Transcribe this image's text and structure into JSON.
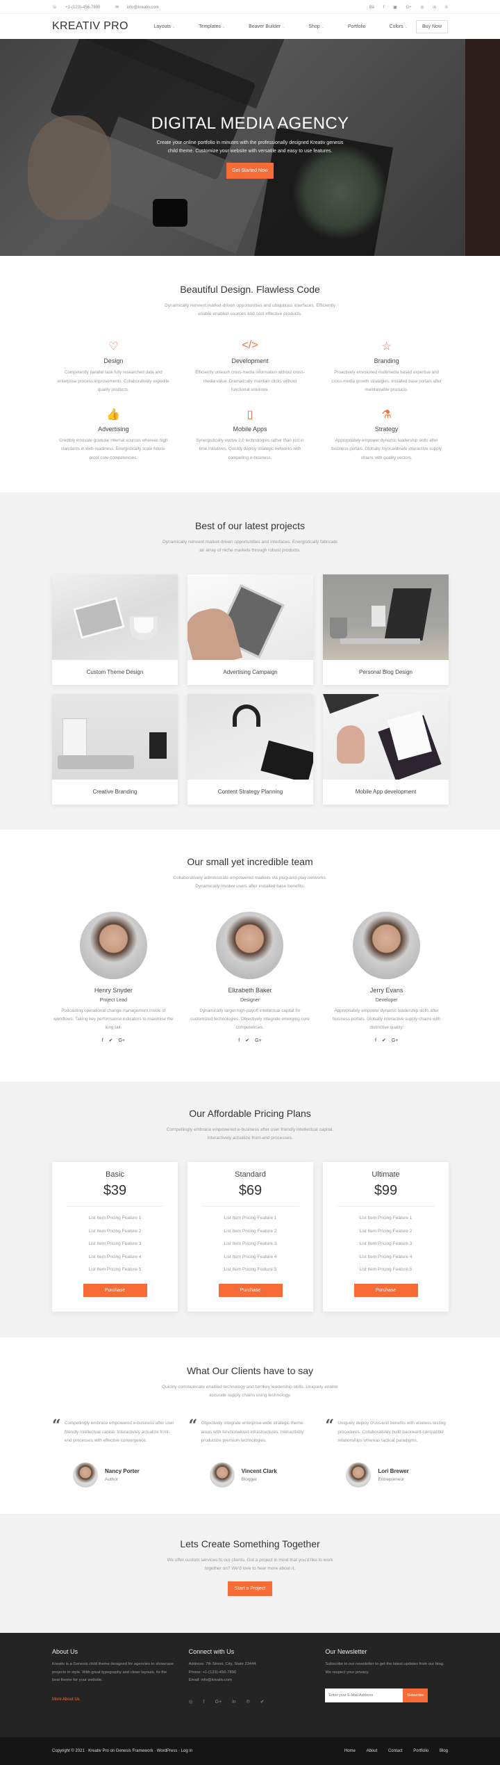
{
  "topbar": {
    "phone": "+1-(123)-456-7890",
    "email": "info@kreativ.com",
    "socials": [
      "behance-icon",
      "facebook-icon",
      "flickr-icon",
      "google-plus-icon",
      "dribbble-icon",
      "linkedin-icon",
      "pinterest-icon"
    ],
    "social_glyphs": [
      "Bē",
      "f",
      "▣",
      "G+",
      "◎",
      "in",
      "℗"
    ]
  },
  "header": {
    "logo": "KREATIV PRO",
    "nav": [
      {
        "label": "Layouts",
        "dropdown": true
      },
      {
        "label": "Templates",
        "dropdown": true
      },
      {
        "label": "Beaver Builder",
        "dropdown": true
      },
      {
        "label": "Shop",
        "dropdown": true
      },
      {
        "label": "Portfolio",
        "dropdown": false
      },
      {
        "label": "Colors",
        "dropdown": true
      }
    ],
    "buy_label": "Buy Now",
    "caret": "⌄"
  },
  "hero": {
    "title": "DIGITAL MEDIA AGENCY",
    "subtitle_1": "Create your online portfolio in minutes with the professionally designed Kreativ genesis",
    "subtitle_2": "child theme. Customize your website with versatile and easy to use features.",
    "button": "Get Started Now"
  },
  "features": {
    "title": "Beautiful Design. Flawless Code",
    "sub_1": "Dynamically reinvent market-driven opportunities and ubiquitous interfaces. Efficiently",
    "sub_2": "enable enabled sources and cost effective products.",
    "items": [
      {
        "icon": "♡",
        "title": "Design",
        "text": "Competently parallel task fully researched data and enterprise process improvements. Collaboratively expedite quality products."
      },
      {
        "icon": "</>",
        "title": "Development",
        "text": "Efficiently unleash cross-media information without cross-media value. Dramatically maintain clicks without functional solutions."
      },
      {
        "icon": "☆",
        "title": "Branding",
        "text": "Proactively envisioned multimedia based expertise and cross-media growth strategies. Installed base portals after maintainable products."
      },
      {
        "icon": "👍",
        "title": "Advertising",
        "text": "Credibly innovate granular internal sources whereas high standards in web-readiness. Energistically scale future-proof core competencies."
      },
      {
        "icon": "▯",
        "title": "Mobile Apps",
        "text": "Synergistically evolve 2.0 technologies rather than just in time initiatives. Quickly deploy strategic networks with compelling e-business."
      },
      {
        "icon": "⚗",
        "title": "Strategy",
        "text": "Appropriately empower dynamic leadership skills after business portals. Globally myocardinate interactive supply chains with quality vectors."
      }
    ]
  },
  "projects": {
    "title": "Best of our latest projects",
    "sub_1": "Dynamically reinvent market-driven opportunities and interfaces. Energistically fabricate",
    "sub_2": "an array of niche markets through robust products.",
    "items": [
      {
        "caption": "Custom Theme Design"
      },
      {
        "caption": "Advertising Campaign"
      },
      {
        "caption": "Personal Blog Design"
      },
      {
        "caption": "Creative Branding"
      },
      {
        "caption": "Content Strategy Planning"
      },
      {
        "caption": "Mobile App development"
      }
    ]
  },
  "team": {
    "title": "Our small yet incredible team",
    "sub_1": "Collaboratively administrate empowered markets via plug-and-play networks.",
    "sub_2": "Dynamically involve users after installed base benefits.",
    "members": [
      {
        "name": "Henry Snyder",
        "role": "Project Lead",
        "bio": "Podcasting operational change management inside of workflows. Taking key performance indicators to maximise the long tail."
      },
      {
        "name": "Elizabeth Baker",
        "role": "Designer",
        "bio": "Dynamically target high-payoff intellectual capital for customized technologies. Objectively integrate emerging core competencies."
      },
      {
        "name": "Jerry Evans",
        "role": "Developer",
        "bio": "Appropriately empower dynamic leadership skills after business portals. Globally interactive supply chains with distinctive quality."
      }
    ],
    "social": {
      "facebook": "f",
      "twitter": "🐦",
      "google": "G+"
    }
  },
  "pricing": {
    "title": "Our Affordable Pricing Plans",
    "sub_1": "Compellingly embrace empowered e-business after user friendly intellectual capital.",
    "sub_2": "Interactively actualize front-end processes.",
    "plans": [
      {
        "name": "Basic",
        "price": "$39",
        "features": [
          "List Item Pricing Feature 1",
          "List Item Pricing Feature 2",
          "List Item Pricing Feature 3",
          "List Item Pricing Feature 4",
          "List Item Pricing Feature 5"
        ],
        "button": "Purchase"
      },
      {
        "name": "Standard",
        "price": "$69",
        "features": [
          "List Item Pricing Feature 1",
          "List Item Pricing Feature 2",
          "List Item Pricing Feature 3",
          "List Item Pricing Feature 4",
          "List Item Pricing Feature 5"
        ],
        "button": "Purchase"
      },
      {
        "name": "Ultimate",
        "price": "$99",
        "features": [
          "List Item Pricing Feature 1",
          "List Item Pricing Feature 2",
          "List Item Pricing Feature 3",
          "List Item Pricing Feature 4",
          "List Item Pricing Feature 5"
        ],
        "button": "Purchase"
      }
    ]
  },
  "testimonials": {
    "title": "What Our Clients have to say",
    "sub_1": "Quickly communicate enabled technology and turnkey leadership skills. Uniquely enable",
    "sub_2": "accurate supply chains using technology.",
    "quote_mark": "“",
    "items": [
      {
        "quote": "Compellingly embrace empowered e-business after user friendly intellectual capital. Interactively actualize front-end processes with effective convergence.",
        "name": "Nancy Porter",
        "role": "Author"
      },
      {
        "quote": "Objectively integrate enterprise-wide strategic theme areas with functionalized infrastructures. Interactively productize premium technologies.",
        "name": "Vincent Clark",
        "role": "Blogger"
      },
      {
        "quote": "Uniquely deploy cross-unit benefits with wireless testing procedures. Collaboratively build backward-compatible relationships whereas tactical paradigms.",
        "name": "Lori Brewer",
        "role": "Entrepreneur"
      }
    ]
  },
  "cta": {
    "title": "Lets Create Something Together",
    "sub_1": "We offer custom services to our clients. Got a project in mind that you'd like to work",
    "sub_2": "together on? We'd love to hear more about it.",
    "button": "Start a Project"
  },
  "footer": {
    "about": {
      "title": "About Us",
      "text": "Kreativ is a Genesis child theme designed for agencies to showcase projects in style. With great typography and clean layouts, its the best theme for your website.",
      "link": "More About Us"
    },
    "connect": {
      "title": "Connect with Us",
      "address": "Address: 7th Street, City, State 23444",
      "phone": "Phone: +1-(123)-456-7890",
      "email": "Email: info@kreativ.com",
      "socials": [
        "◎",
        "f",
        "G+",
        "in",
        "℗",
        "🐦"
      ]
    },
    "newsletter": {
      "title": "Our Newsletter",
      "text": "Subscribe to our newsletter to get the latest updates from our blog. We respect your privacy.",
      "placeholder": "Enter your E-Mail Address",
      "button": "Subscribe"
    }
  },
  "bottom": {
    "copyright": "Copyright © 2021 · Kreativ Pro on Genesis Framework · WordPress · Log in",
    "links": [
      "Home",
      "About",
      "Contact",
      "Portfolio",
      "Blog"
    ]
  },
  "colors": {
    "accent": "#f76b36",
    "footer_bg": "#242424",
    "bottom_bg": "#151515",
    "section_alt_bg": "#f2f2f2"
  }
}
